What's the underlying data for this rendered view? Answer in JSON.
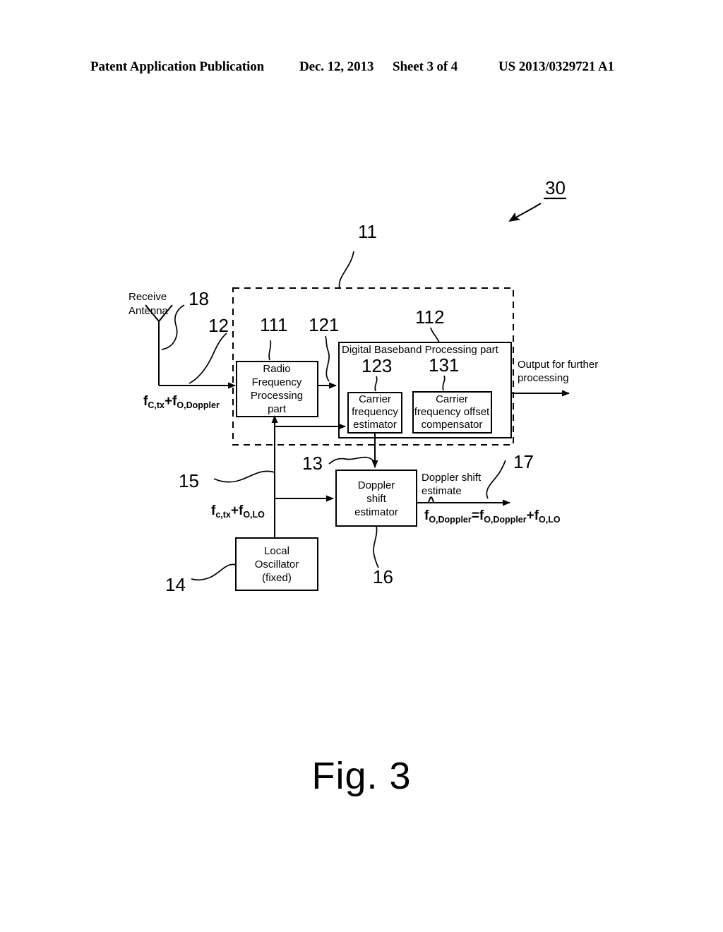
{
  "header": {
    "publication": "Patent Application Publication",
    "date": "Dec. 12, 2013",
    "sheet": "Sheet 3 of 4",
    "patent_number": "US 2013/0329721 A1"
  },
  "figure": {
    "caption": "Fig. 3",
    "system_ref": "30"
  },
  "blocks": {
    "receiver_dashed": {
      "ref": "11"
    },
    "rf_part": {
      "label_lines": [
        "Radio",
        "Frequency",
        "Processing",
        "part"
      ],
      "ref": "111"
    },
    "baseband_part": {
      "title": "Digital Baseband Processing part",
      "ref": "112"
    },
    "carrier_freq_estimator": {
      "label_lines": [
        "Carrier",
        "frequency",
        "estimator"
      ],
      "ref": "123"
    },
    "carrier_freq_offset_compensator": {
      "label_lines": [
        "Carrier",
        "frequency offset",
        "compensator"
      ],
      "ref": "131"
    },
    "doppler_shift_estimator": {
      "label_lines": [
        "Doppler",
        "shift",
        "estimator"
      ],
      "ref": "16"
    },
    "local_oscillator": {
      "label_lines": [
        "Local",
        "Oscillator",
        "(fixed)"
      ],
      "ref": "14"
    }
  },
  "antenna": {
    "label_lines": [
      "Receive",
      "Antenna"
    ],
    "ref": "18"
  },
  "signals": {
    "rx_input": {
      "ref": "12",
      "formula": "fC,tx+fO,Doppler",
      "parts": [
        {
          "base": "f",
          "sub": "C,tx"
        },
        {
          "base": "+f",
          "sub": "O,Doppler"
        }
      ]
    },
    "lo_output": {
      "ref": "15",
      "formula": "fc,tx+fO,LO",
      "parts": [
        {
          "base": "f",
          "sub": "c,tx"
        },
        {
          "base": "+f",
          "sub": "O,LO"
        }
      ]
    },
    "rf_to_baseband": {
      "ref": "121"
    },
    "baseband_to_doppler": {
      "ref": "13"
    },
    "output": {
      "label_lines": [
        "Output for further",
        "processing"
      ]
    },
    "doppler_estimate": {
      "ref": "17",
      "label_lines": [
        "Doppler shift",
        "estimate"
      ],
      "formula": "f̂O,Doppler=fO,Doppler+fO,LO",
      "parts": [
        {
          "base": "f",
          "sub": "O,Doppler",
          "hat": true
        },
        {
          "base": "=f",
          "sub": "O,Doppler"
        },
        {
          "base": "+f",
          "sub": "O,LO"
        }
      ]
    }
  }
}
